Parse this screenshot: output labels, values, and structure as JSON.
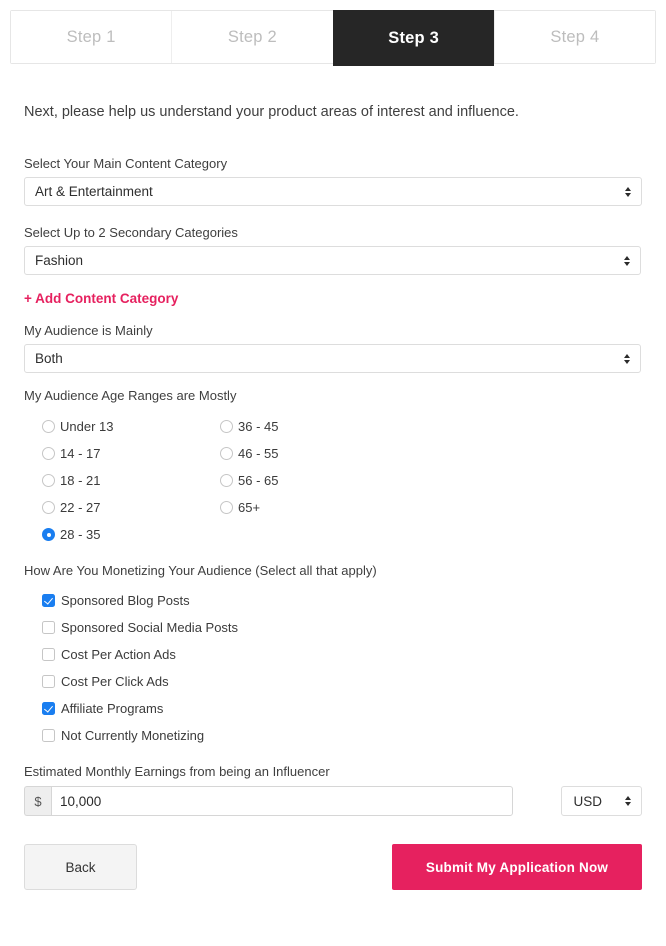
{
  "steps": {
    "items": [
      {
        "label": "Step 1",
        "active": false
      },
      {
        "label": "Step 2",
        "active": false
      },
      {
        "label": "Step 3",
        "active": true
      },
      {
        "label": "Step 4",
        "active": false
      }
    ]
  },
  "form": {
    "intro": "Next, please help us understand your product areas of interest and influence.",
    "main_category": {
      "label": "Select Your Main Content Category",
      "value": "Art & Entertainment"
    },
    "secondary_category": {
      "label": "Select Up to 2 Secondary Categories",
      "value": "Fashion"
    },
    "add_category_link": "+ Add Content Category",
    "audience_gender": {
      "label": "My Audience is Mainly",
      "value": "Both"
    },
    "age_ranges": {
      "label": "My Audience Age Ranges are Mostly",
      "left_column": [
        {
          "label": "Under 13",
          "checked": false
        },
        {
          "label": "14 - 17",
          "checked": false
        },
        {
          "label": "18 - 21",
          "checked": false
        },
        {
          "label": "22 - 27",
          "checked": false
        },
        {
          "label": "28 - 35",
          "checked": true
        }
      ],
      "right_column": [
        {
          "label": "36 - 45",
          "checked": false
        },
        {
          "label": "46 - 55",
          "checked": false
        },
        {
          "label": "56 - 65",
          "checked": false
        },
        {
          "label": "65+",
          "checked": false
        }
      ]
    },
    "monetizing": {
      "label": "How Are You Monetizing Your Audience (Select all that apply)",
      "options": [
        {
          "label": "Sponsored Blog Posts",
          "checked": true
        },
        {
          "label": "Sponsored Social Media Posts",
          "checked": false
        },
        {
          "label": "Cost Per Action Ads",
          "checked": false
        },
        {
          "label": "Cost Per Click Ads",
          "checked": false
        },
        {
          "label": "Affiliate Programs",
          "checked": true
        },
        {
          "label": "Not Currently Monetizing",
          "checked": false
        }
      ]
    },
    "earnings": {
      "label": "Estimated Monthly Earnings from being an Influencer",
      "currency_symbol": "$",
      "value": "10,000",
      "placeholder": "",
      "currency": "USD"
    }
  },
  "footer": {
    "back_label": "Back",
    "submit_label": "Submit My Application Now"
  },
  "colors": {
    "accent_pink": "#e6215f",
    "active_tab_bg": "#262626",
    "control_blue": "#1a7ef0"
  }
}
